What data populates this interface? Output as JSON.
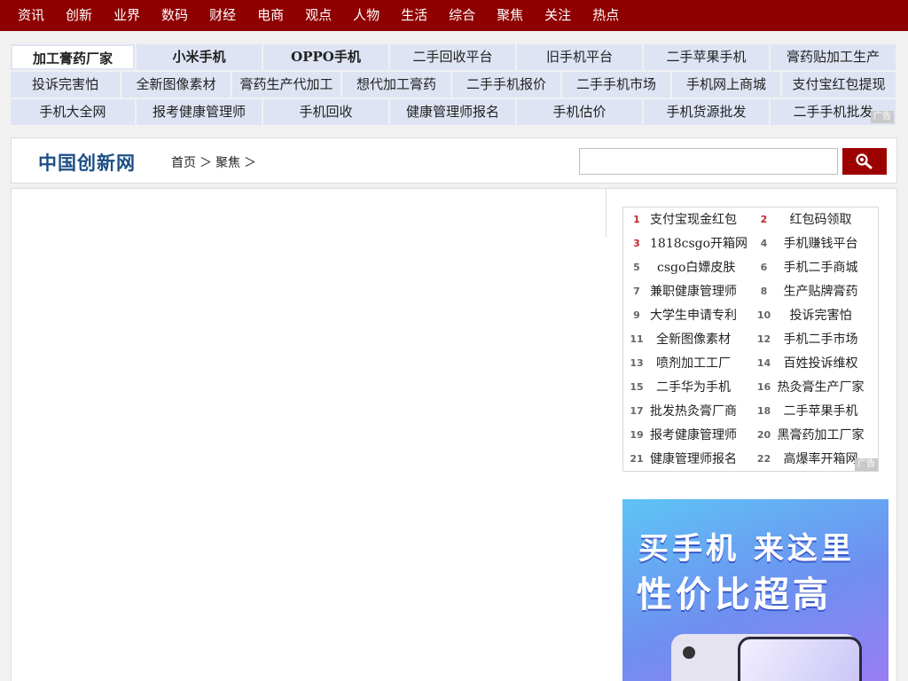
{
  "topnav": [
    "资讯",
    "创新",
    "业界",
    "数码",
    "财经",
    "电商",
    "观点",
    "人物",
    "生活",
    "综合",
    "聚焦",
    "关注",
    "热点"
  ],
  "linkgrid": {
    "rows": [
      [
        "加工膏药厂家",
        "小米手机",
        "OPPO手机",
        "二手回收平台",
        "旧手机平台",
        "二手苹果手机",
        "膏药贴加工生产"
      ],
      [
        "投诉完害怕",
        "全新图像素材",
        "膏药生产代加工",
        "想代加工膏药",
        "二手手机报价",
        "二手手机市场",
        "手机网上商城",
        "支付宝红包提现"
      ],
      [
        "手机大全网",
        "报考健康管理师",
        "手机回收",
        "健康管理师报名",
        "手机估价",
        "手机货源批发",
        "二手手机批发"
      ]
    ],
    "ad_label": "广告"
  },
  "header": {
    "logo": "中国创新网",
    "breadcrumb": [
      "首页",
      "＞",
      "聚焦",
      "＞"
    ],
    "search_placeholder": ""
  },
  "ranklist": {
    "items": [
      {
        "num": "1",
        "text": "支付宝现金红包"
      },
      {
        "num": "2",
        "text": "红包码领取"
      },
      {
        "num": "3",
        "text": "1818csgo开箱网"
      },
      {
        "num": "4",
        "text": "手机赚钱平台"
      },
      {
        "num": "5",
        "text": "csgo白嫖皮肤"
      },
      {
        "num": "6",
        "text": "手机二手商城"
      },
      {
        "num": "7",
        "text": "兼职健康管理师"
      },
      {
        "num": "8",
        "text": "生产贴牌膏药"
      },
      {
        "num": "9",
        "text": "大学生申请专利"
      },
      {
        "num": "10",
        "text": "投诉完害怕"
      },
      {
        "num": "11",
        "text": "全新图像素材"
      },
      {
        "num": "12",
        "text": "手机二手市场"
      },
      {
        "num": "13",
        "text": "喷剂加工工厂"
      },
      {
        "num": "14",
        "text": "百姓投诉维权"
      },
      {
        "num": "15",
        "text": "二手华为手机"
      },
      {
        "num": "16",
        "text": "热灸膏生产厂家"
      },
      {
        "num": "17",
        "text": "批发热灸膏厂商"
      },
      {
        "num": "18",
        "text": "二手苹果手机"
      },
      {
        "num": "19",
        "text": "报考健康管理师"
      },
      {
        "num": "20",
        "text": "黑膏药加工厂家"
      },
      {
        "num": "21",
        "text": "健康管理师报名"
      },
      {
        "num": "22",
        "text": "高爆率开箱网"
      }
    ],
    "ad_label": "广告"
  },
  "banner": {
    "line1": "买手机 来这里",
    "line2": "性价比超高"
  },
  "colors": {
    "topnav_bg": "#8f0000",
    "link_cell_bg": "#dfe4f4",
    "hot_rank": "#c0272d",
    "search_button": "#9c0000",
    "logo": "#1c4f86"
  }
}
